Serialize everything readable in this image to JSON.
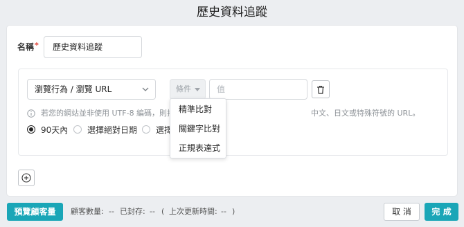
{
  "dialog": {
    "title": "歷史資料追蹤"
  },
  "form": {
    "name_label": "名稱",
    "required_mark": "*",
    "name_value": "歷史資料追蹤"
  },
  "condition": {
    "type_select_value": "瀏覽行為 / 瀏覽 URL",
    "condition_select_placeholder": "條件",
    "value_placeholder": "值",
    "hint_part1": "若您的網站並非使用 UTF-8 編碼，則揭",
    "hint_part2": "中文、日文或特殊符號的 URL。",
    "radio_options": [
      {
        "label": "90天內",
        "checked": true
      },
      {
        "label": "選擇絕對日期",
        "checked": false
      },
      {
        "label": "選擇",
        "checked": false
      }
    ]
  },
  "condition_dropdown": {
    "options": [
      "精準比對",
      "關鍵字比對",
      "正規表達式"
    ]
  },
  "footer": {
    "preview_label": "預覽顧客量",
    "customer_count_label": "顧客數量:",
    "customer_count_value": "--",
    "sealed_label": "已封存:",
    "sealed_value": "--",
    "last_updated_open": "(",
    "last_updated_label": "上次更新時間:",
    "last_updated_value": "--",
    "last_updated_close": ")",
    "cancel_label": "取 消",
    "done_label": "完 成"
  },
  "icons": {
    "chevron": "chevron-down-icon",
    "caret": "caret-down-icon",
    "trash": "trash-icon",
    "info": "info-circle-icon",
    "add": "plus-circle-icon"
  },
  "colors": {
    "accent": "#1aa6b7",
    "required": "#e0453a"
  }
}
